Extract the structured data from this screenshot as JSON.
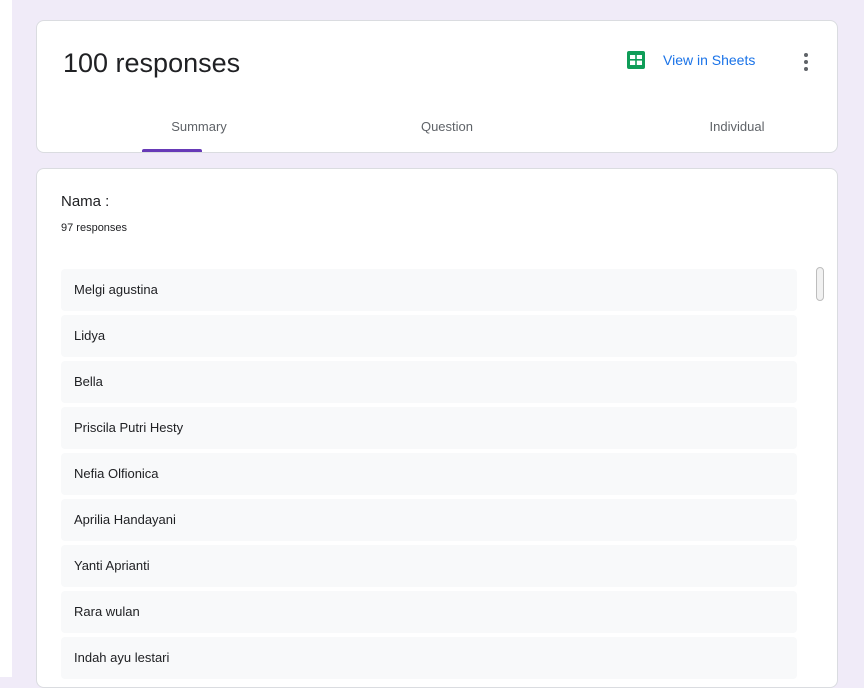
{
  "header": {
    "title": "100 responses",
    "sheets_label": "View in Sheets",
    "tabs": [
      {
        "label": "Summary",
        "active": true
      },
      {
        "label": "Question",
        "active": false
      },
      {
        "label": "Individual",
        "active": false
      }
    ]
  },
  "question": {
    "title": "Nama :",
    "response_count": "97 responses",
    "answers": [
      "Melgi agustina",
      "Lidya",
      "Bella",
      "Priscila Putri Hesty",
      "Nefia Olfionica",
      "Aprilia Handayani",
      "Yanti Aprianti",
      "Rara wulan",
      "Indah ayu lestari"
    ]
  },
  "colors": {
    "accent": "#673ab7",
    "link": "#1a73e8",
    "sheets_green": "#0f9d58",
    "background": "#f0ebf8"
  },
  "icons": {
    "sheets": "google-sheets-icon",
    "more": "more-vert-icon"
  }
}
